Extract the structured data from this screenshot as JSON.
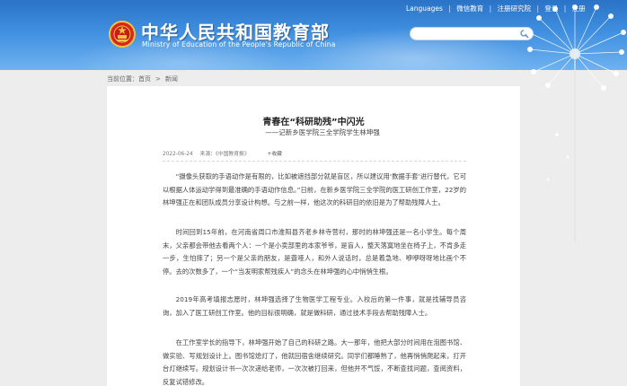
{
  "header": {
    "title_cn": "中华人民共和国教育部",
    "title_en": "Ministry of Education of the People's Republic of China",
    "links": [
      "Languages",
      "微信教育",
      "注册研究院",
      "登录",
      "注册"
    ],
    "search": {
      "placeholder": ""
    }
  },
  "breadcrumb": {
    "label": "当前位置：",
    "home": "首页",
    "current": "新闻"
  },
  "article": {
    "title": "青春在“科研助残”中闪光",
    "subtitle": "——记新乡医学院三全学院学生林坤强",
    "date": "2022-06-24",
    "source": "来源：《中国教育报》",
    "favorite": "收藏",
    "paragraphs": [
      "“摄像头获取的手语动作是有限的，比如被遮挡部分就是盲区，所以建议用‘数据手套’进行替代，它可以根据人体运动学得到最准确的手语动作信息。”日前，在新乡医学院三全学院的医工研创工作室，22岁的林坤强正在和团队成员分享设计构想。与之前一样，他这次的科研目的依旧是为了帮助残障人士。",
      "时间回到15年前，在河南省周口市淮阳县齐老乡林寺营村，那时的林坤强还是一名小学生。每个周末，父亲都会带他去看两个人：一个是小卖部里的本家爷爷，是盲人，整天落寞地坐在椅子上，不肯多走一步，生怕摔了；另一个是父亲的朋友，是聋哑人，和外人说话时，总是着急地、咿咿呀呀地比画个不停。去的次数多了，一个“当发明家帮残疾人”的念头在林坤强的心中悄悄生根。",
      "2019年高考填报志愿时，林坤强选择了生物医学工程专业。入校后的第一件事，就是找辅导员咨询，加入了医工研创工作室。他的目标很明确，就是做科研，通过技术手段去帮助残障人士。",
      "在工作室学长的指导下，林坤强开始了自己的科研之路。大一那年，他把大部分时间用在泡图书馆、做实验、写规划设计上。图书馆熄灯了，他就回宿舍继续研究。同学们都睡熟了，他再悄悄爬起来，打开台灯继续写。规划设计书一次次递给老师，一次次被打回来，但他并不气馁，不断查找问题，查阅资料，反复试错修改。"
    ]
  }
}
